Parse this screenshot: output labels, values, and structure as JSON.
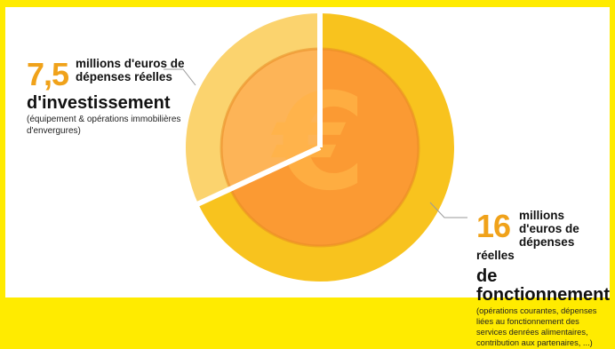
{
  "colors": {
    "frame": "#FFEB00",
    "coin_outer": "#F8C31E",
    "coin_inner": "#FB9A33",
    "coin_outer_light": "#FBD36E",
    "coin_inner_light": "#FDB457",
    "accent_number": "#F0A21A"
  },
  "chart_data": {
    "type": "pie",
    "unit": "millions d'euros",
    "slices": [
      {
        "value": 7.5,
        "label": "d'investissement"
      },
      {
        "value": 16,
        "label": "de fonctionnement"
      }
    ],
    "center_icon": "euro-icon"
  },
  "invest": {
    "value": "7,5",
    "head": "millions d'euros de dépenses réelles",
    "emphasis": "d'investissement",
    "note": "(équipement & opérations immobilières d'envergures)"
  },
  "fonct": {
    "value": "16",
    "head": "millions d'euros de dépenses réelles",
    "emphasis": "de fonctionnement",
    "note": "(opérations courantes, dépenses liées au fonctionnement des services denrées alimentaires, contribution aux partenaires, ...)"
  }
}
